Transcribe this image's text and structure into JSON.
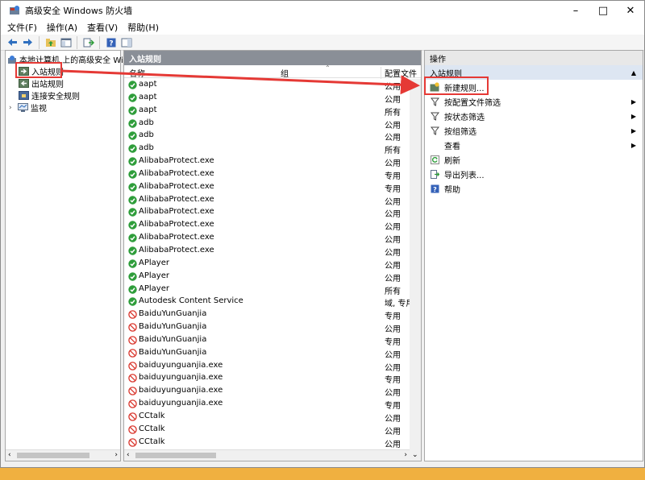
{
  "window": {
    "title": "高级安全 Windows 防火墙"
  },
  "menu": [
    "文件(F)",
    "操作(A)",
    "查看(V)",
    "帮助(H)"
  ],
  "tree": {
    "root": "本地计算机 上的高级安全 Wind",
    "items": [
      "入站规则",
      "出站规则",
      "连接安全规则",
      "监视"
    ]
  },
  "middle": {
    "header": "入站规则",
    "columns": [
      "名称",
      "组",
      "配置文件"
    ],
    "rows": [
      {
        "name": "aapt",
        "profile": "公用",
        "status": "allow"
      },
      {
        "name": "aapt",
        "profile": "公用",
        "status": "allow"
      },
      {
        "name": "aapt",
        "profile": "所有",
        "status": "allow"
      },
      {
        "name": "adb",
        "profile": "公用",
        "status": "allow"
      },
      {
        "name": "adb",
        "profile": "公用",
        "status": "allow"
      },
      {
        "name": "adb",
        "profile": "所有",
        "status": "allow"
      },
      {
        "name": "AlibabaProtect.exe",
        "profile": "公用",
        "status": "allow"
      },
      {
        "name": "AlibabaProtect.exe",
        "profile": "专用",
        "status": "allow"
      },
      {
        "name": "AlibabaProtect.exe",
        "profile": "专用",
        "status": "allow"
      },
      {
        "name": "AlibabaProtect.exe",
        "profile": "公用",
        "status": "allow"
      },
      {
        "name": "AlibabaProtect.exe",
        "profile": "公用",
        "status": "allow"
      },
      {
        "name": "AlibabaProtect.exe",
        "profile": "公用",
        "status": "allow"
      },
      {
        "name": "AlibabaProtect.exe",
        "profile": "公用",
        "status": "allow"
      },
      {
        "name": "AlibabaProtect.exe",
        "profile": "公用",
        "status": "allow"
      },
      {
        "name": "APlayer",
        "profile": "公用",
        "status": "allow"
      },
      {
        "name": "APlayer",
        "profile": "公用",
        "status": "allow"
      },
      {
        "name": "APlayer",
        "profile": "所有",
        "status": "allow"
      },
      {
        "name": "Autodesk Content Service",
        "profile": "域, 专用",
        "status": "allow"
      },
      {
        "name": "BaiduYunGuanjia",
        "profile": "专用",
        "status": "block"
      },
      {
        "name": "BaiduYunGuanjia",
        "profile": "公用",
        "status": "block"
      },
      {
        "name": "BaiduYunGuanjia",
        "profile": "专用",
        "status": "block"
      },
      {
        "name": "BaiduYunGuanjia",
        "profile": "公用",
        "status": "block"
      },
      {
        "name": "baiduyunguanjia.exe",
        "profile": "公用",
        "status": "block"
      },
      {
        "name": "baiduyunguanjia.exe",
        "profile": "专用",
        "status": "block"
      },
      {
        "name": "baiduyunguanjia.exe",
        "profile": "公用",
        "status": "block"
      },
      {
        "name": "baiduyunguanjia.exe",
        "profile": "专用",
        "status": "block"
      },
      {
        "name": "CCtalk",
        "profile": "公用",
        "status": "block"
      },
      {
        "name": "CCtalk",
        "profile": "公用",
        "status": "block"
      },
      {
        "name": "CCtalk",
        "profile": "公用",
        "status": "block"
      }
    ]
  },
  "actions": {
    "header": "操作",
    "section": "入站规则",
    "items": [
      {
        "label": "新建规则...",
        "icon": "new-rule-icon",
        "submenu": false
      },
      {
        "label": "按配置文件筛选",
        "icon": "filter-icon",
        "submenu": true
      },
      {
        "label": "按状态筛选",
        "icon": "filter-icon",
        "submenu": true
      },
      {
        "label": "按组筛选",
        "icon": "filter-icon",
        "submenu": true
      },
      {
        "label": "查看",
        "icon": "",
        "submenu": true
      },
      {
        "label": "刷新",
        "icon": "refresh-icon",
        "submenu": false
      },
      {
        "label": "导出列表...",
        "icon": "export-icon",
        "submenu": false
      },
      {
        "label": "帮助",
        "icon": "help-icon",
        "submenu": false
      }
    ]
  },
  "colors": {
    "annotation_red": "#e53935",
    "allow_green": "#2e9d3a",
    "block_red": "#d9342b"
  }
}
